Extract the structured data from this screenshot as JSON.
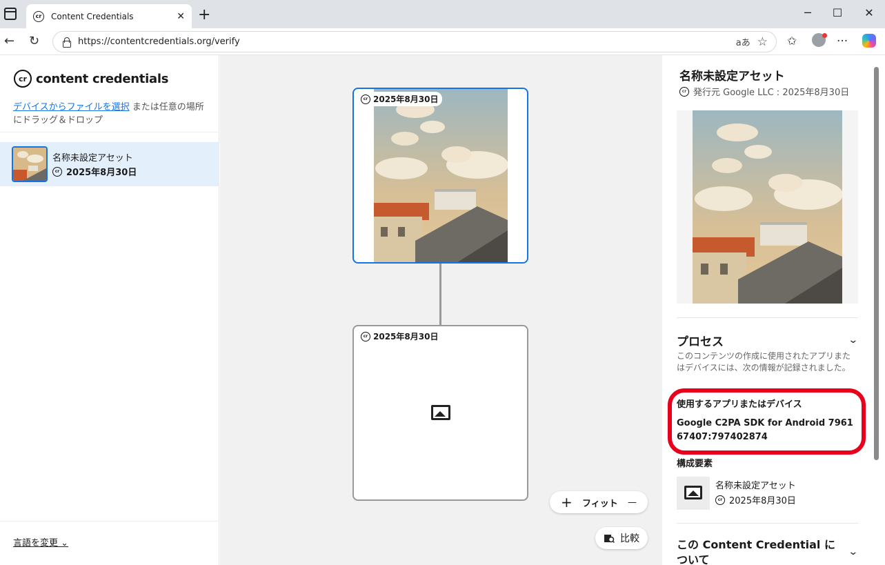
{
  "browser": {
    "tab_title": "Content Credentials",
    "tab_close": "✕",
    "new_tab": "+",
    "url": "https://contentcredentials.org/verify",
    "read_aloud": "aあ",
    "minimize": "─",
    "maximize": "☐",
    "close": "✕",
    "back": "←",
    "reload": "↻",
    "star": "☆",
    "favorites": "✩",
    "more": "···"
  },
  "left": {
    "logo_mark": "cr",
    "logo_text": "content credentials",
    "drop_link": "デバイスからファイルを選択",
    "drop_text": " または任意の場所にドラッグ＆ドロップ",
    "asset_title": "名称未設定アセット",
    "asset_date": "2025年8月30日",
    "language": "言語を変更 ⌄"
  },
  "canvas": {
    "node1_date": "2025年8月30日",
    "node2_date": "2025年8月30日",
    "zoom_in": "+",
    "fit": "フィット",
    "zoom_out": "—",
    "compare": "比較"
  },
  "right": {
    "title": "名称未設定アセット",
    "issuer": "発行元 Google LLC : 2025年8月30日",
    "process_heading": "プロセス",
    "process_desc": "このコンテンツの作成に使用されたアプリまたはデバイスには、次の情報が記録されました。",
    "app_label": "使用するアプリまたはデバイス",
    "app_value": "Google C2PA SDK for Android 796167407:797402874",
    "components_label": "構成要素",
    "component_title": "名称未設定アセット",
    "component_date": "2025年8月30日",
    "about_heading": "この Content Credential について"
  },
  "colors": {
    "accent": "#1473e6",
    "highlight": "#e8001c",
    "selected_row": "#e3f0fc"
  }
}
